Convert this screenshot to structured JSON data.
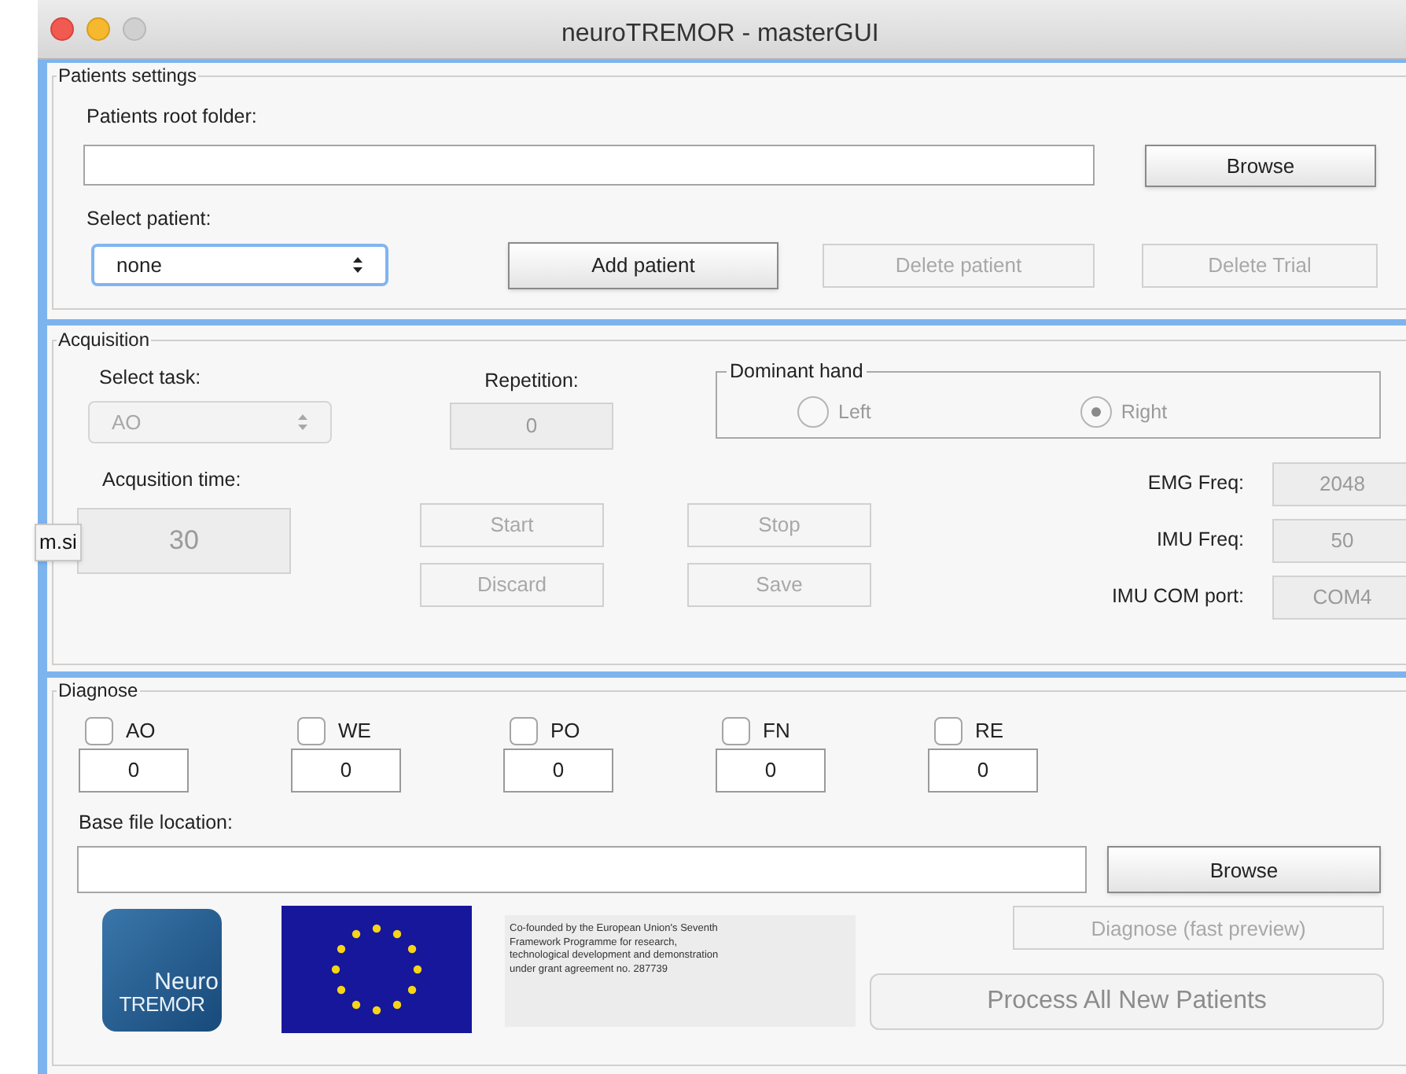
{
  "window": {
    "title": "neuroTREMOR - masterGUI"
  },
  "tooltip": {
    "text": "m.si"
  },
  "patients_settings": {
    "legend": "Patients settings",
    "root_folder_label": "Patients root folder:",
    "browse_button": {
      "label": "Browse",
      "disabled": false
    },
    "select_patient_label": "Select patient:",
    "patient_select": {
      "value": "none",
      "focused": true
    },
    "buttons": [
      {
        "label": "Add patient",
        "disabled": false
      },
      {
        "label": "Delete patient",
        "disabled": true
      },
      {
        "label": "Delete Trial",
        "disabled": true
      }
    ]
  },
  "acquisition": {
    "legend": "Acquisition",
    "task_label": "Select task:",
    "task_select": {
      "value": "AO",
      "disabled": true
    },
    "repetition_label": "Repetition:",
    "repetition_field": {
      "value": "0",
      "disabled": true
    },
    "dominant_hand": {
      "legend": "Dominant hand",
      "disabled": true,
      "options": [
        {
          "label": "Left",
          "selected": false
        },
        {
          "label": "Right",
          "selected": true
        }
      ]
    },
    "time_label": "Acqusition time:",
    "time_field": {
      "value": "30",
      "disabled": true
    },
    "buttons": [
      {
        "label": "Start",
        "disabled": true
      },
      {
        "label": "Stop",
        "disabled": true
      },
      {
        "label": "Discard",
        "disabled": true
      },
      {
        "label": "Save",
        "disabled": true
      }
    ],
    "params": [
      {
        "label": "EMG Freq:",
        "value": "2048"
      },
      {
        "label": "IMU Freq:",
        "value": "50"
      },
      {
        "label": "IMU COM port:",
        "value": "COM4"
      }
    ]
  },
  "diagnose": {
    "legend": "Diagnose",
    "tasks": [
      {
        "label": "AO",
        "checked": false,
        "count": "0"
      },
      {
        "label": "WE",
        "checked": false,
        "count": "0"
      },
      {
        "label": "PO",
        "checked": false,
        "count": "0"
      },
      {
        "label": "FN",
        "checked": false,
        "count": "0"
      },
      {
        "label": "RE",
        "checked": false,
        "count": "0"
      }
    ],
    "base_label": "Base file location:",
    "browse_button": {
      "label": "Browse",
      "disabled": false
    },
    "logo": {
      "line_1": "Neuro",
      "line_2": "TREMOR"
    },
    "funding_text": "Co-founded by the European Union's Seventh Framework Programme for research, technological development and demonstration under grant agreement no. 287739",
    "diagnose_button": {
      "label": "Diagnose (fast preview)",
      "disabled": true
    },
    "process_button": {
      "label": "Process All New Patients",
      "disabled": true
    }
  }
}
